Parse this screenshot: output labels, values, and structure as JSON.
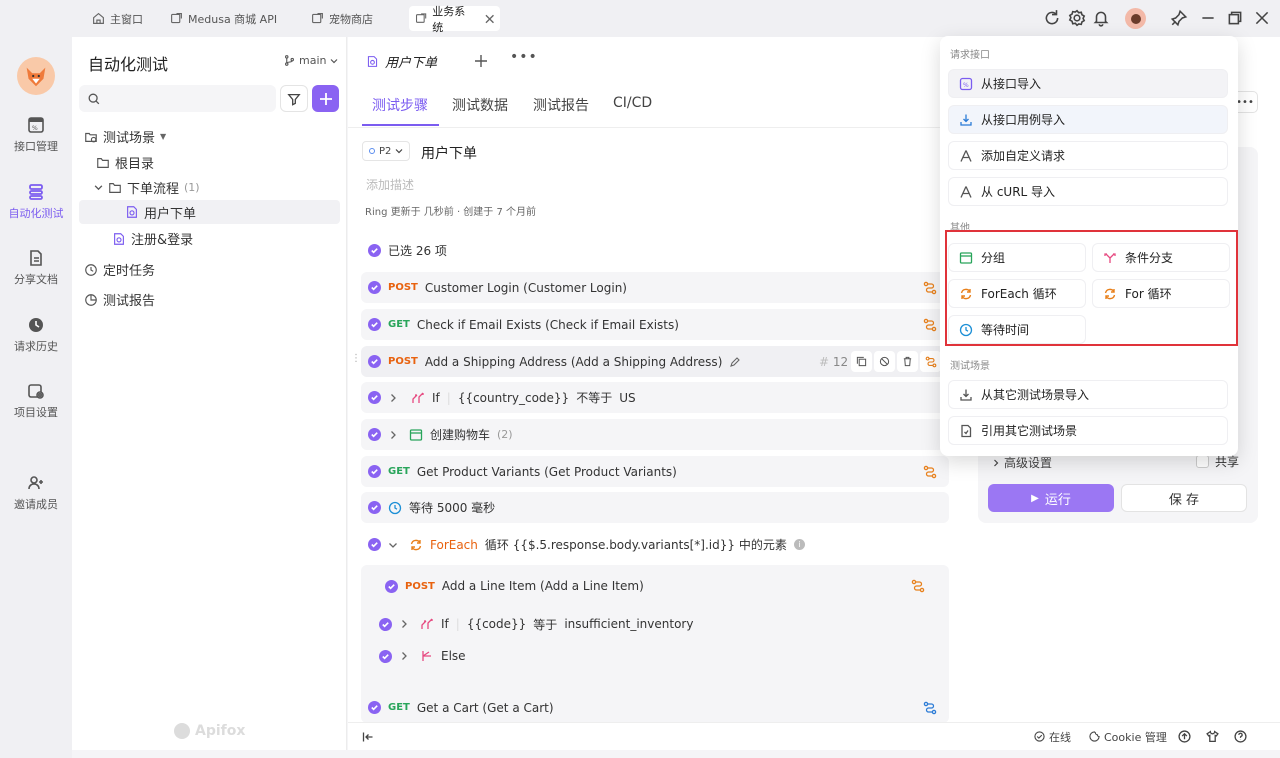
{
  "titlebar": {
    "tabs": [
      {
        "label": "主窗口",
        "icon": "home-icon"
      },
      {
        "label": "Medusa 商城 API",
        "icon": "project-icon"
      },
      {
        "label": "宠物商店",
        "icon": "project-icon"
      },
      {
        "label": "业务系统",
        "icon": "project-icon",
        "active": true
      }
    ]
  },
  "nav": {
    "items": [
      {
        "label": "接口管理",
        "icon": "api-icon"
      },
      {
        "label": "自动化测试",
        "icon": "automation-icon",
        "active": true
      },
      {
        "label": "分享文档",
        "icon": "doc-icon"
      },
      {
        "label": "请求历史",
        "icon": "history-icon"
      },
      {
        "label": "项目设置",
        "icon": "settings-icon"
      },
      {
        "label": "邀请成员",
        "icon": "invite-icon"
      }
    ]
  },
  "sidebar": {
    "title": "自动化测试",
    "branch": "main",
    "tree": {
      "scenes": "测试场景",
      "root": "根目录",
      "folder": "下单流程",
      "folder_count": "(1)",
      "case1": "用户下单",
      "case2": "注册&登录",
      "scheduled": "定时任务",
      "reports": "测试报告"
    }
  },
  "main": {
    "tab_title": "用户下单",
    "subtabs": [
      "测试步骤",
      "测试数据",
      "测试报告",
      "CI/CD"
    ],
    "priority": "P2",
    "scene_name": "用户下单",
    "desc_placeholder": "添加描述",
    "meta": "Ring 更新于 几秒前 · 创建于 7 个月前",
    "selected": "已选 26 项",
    "steps": {
      "s1": {
        "method": "POST",
        "name": "Customer Login (Customer Login)"
      },
      "s2": {
        "method": "GET",
        "name": "Check if Email Exists (Check if Email Exists)"
      },
      "s3": {
        "method": "POST",
        "name": "Add a Shipping Address (Add a Shipping Address)",
        "index": "12"
      },
      "s4": {
        "keyword": "If",
        "var": "{{country_code}}",
        "op": "不等于",
        "val": "US"
      },
      "s5": {
        "name": "创建购物车",
        "count": "(2)"
      },
      "s6": {
        "method": "GET",
        "name": "Get Product Variants (Get Product Variants)"
      },
      "s7": {
        "name": "等待 5000 毫秒"
      },
      "s8": {
        "keyword": "ForEach",
        "text": "循环 {{$.5.response.body.variants[*].id}} 中的元素"
      },
      "s8a": {
        "method": "POST",
        "name": "Add a Line Item (Add a Line Item)"
      },
      "s8b": {
        "keyword": "If",
        "var": "{{code}}",
        "op": "等于",
        "val": "insufficient_inventory"
      },
      "s8c": {
        "keyword": "Else"
      },
      "s9": {
        "method": "GET",
        "name": "Get a Cart (Get a Cart)"
      }
    },
    "watermark": "Apifox"
  },
  "dropdown": {
    "sec1": "请求接口",
    "import_api": "从接口导入",
    "import_case": "从接口用例导入",
    "custom_req": "添加自定义请求",
    "curl_import": "从 cURL 导入",
    "sec2": "其他",
    "group": "分组",
    "condition": "条件分支",
    "foreach": "ForEach 循环",
    "for": "For 循环",
    "wait": "等待时间",
    "sec3": "测试场景",
    "import_scene": "从其它测试场景导入",
    "ref_scene": "引用其它测试场景"
  },
  "right": {
    "advanced": "高级设置",
    "share": "共享",
    "run": "运行",
    "save": "保 存"
  },
  "bottom": {
    "online": "在线",
    "cookie": "Cookie 管理"
  },
  "colors": {
    "accent": "#8a63f2",
    "post": "#e8620f",
    "get": "#29a55b",
    "highlight": "#e0333a"
  }
}
